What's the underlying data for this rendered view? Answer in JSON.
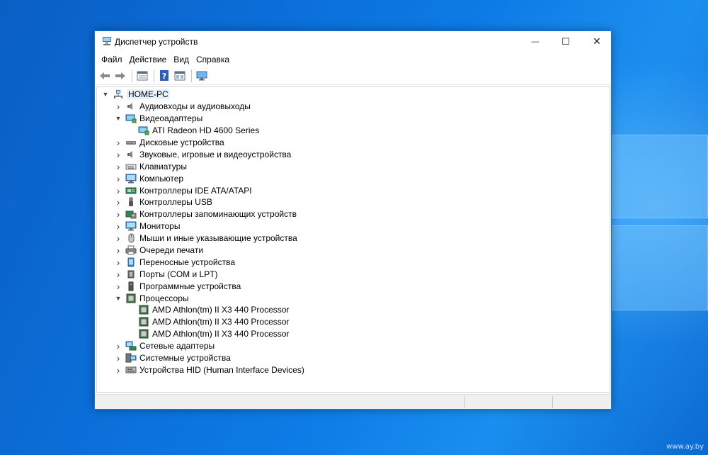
{
  "desktop": {
    "watermark": "www.ay.by"
  },
  "window": {
    "title": "Диспетчер устройств",
    "controls": {
      "minimize": "—",
      "maximize": "☐",
      "close": "✕"
    }
  },
  "menu": [
    "Файл",
    "Действие",
    "Вид",
    "Справка"
  ],
  "toolbar": {
    "buttons": [
      "back-icon",
      "forward-icon",
      "properties-icon",
      "help-icon",
      "show-hidden-icon",
      "monitor-scan-icon"
    ]
  },
  "tree": {
    "root": "HOME-PC",
    "items": [
      {
        "label": "Аудиовходы и аудиовыходы",
        "icon": "speaker-icon",
        "expanded": false
      },
      {
        "label": "Видеоадаптеры",
        "icon": "display-adapter-icon",
        "expanded": true
      },
      {
        "label": "ATI Radeon HD 4600 Series",
        "icon": "display-adapter-icon",
        "child": true
      },
      {
        "label": "Дисковые устройства",
        "icon": "disk-icon",
        "expanded": false
      },
      {
        "label": "Звуковые, игровые и видеоустройства",
        "icon": "speaker-icon",
        "expanded": false
      },
      {
        "label": "Клавиатуры",
        "icon": "keyboard-icon",
        "expanded": false
      },
      {
        "label": "Компьютер",
        "icon": "computer-icon",
        "expanded": false
      },
      {
        "label": "Контроллеры IDE ATA/ATAPI",
        "icon": "ide-controller-icon",
        "expanded": false
      },
      {
        "label": "Контроллеры USB",
        "icon": "usb-icon",
        "expanded": false
      },
      {
        "label": "Контроллеры запоминающих устройств",
        "icon": "storage-controller-icon",
        "expanded": false
      },
      {
        "label": "Мониторы",
        "icon": "monitor-icon",
        "expanded": false
      },
      {
        "label": "Мыши и иные указывающие устройства",
        "icon": "mouse-icon",
        "expanded": false
      },
      {
        "label": "Очереди печати",
        "icon": "printer-icon",
        "expanded": false
      },
      {
        "label": "Переносные устройства",
        "icon": "portable-device-icon",
        "expanded": false
      },
      {
        "label": "Порты (COM и LPT)",
        "icon": "port-icon",
        "expanded": false
      },
      {
        "label": "Программные устройства",
        "icon": "software-device-icon",
        "expanded": false
      },
      {
        "label": "Процессоры",
        "icon": "processor-icon",
        "expanded": true
      },
      {
        "label": "AMD Athlon(tm) II X3 440 Processor",
        "icon": "processor-icon",
        "child": true
      },
      {
        "label": "AMD Athlon(tm) II X3 440 Processor",
        "icon": "processor-icon",
        "child": true
      },
      {
        "label": "AMD Athlon(tm) II X3 440 Processor",
        "icon": "processor-icon",
        "child": true
      },
      {
        "label": "Сетевые адаптеры",
        "icon": "network-adapter-icon",
        "expanded": false
      },
      {
        "label": "Системные устройства",
        "icon": "system-device-icon",
        "expanded": false
      },
      {
        "label": "Устройства HID (Human Interface Devices)",
        "icon": "hid-icon",
        "expanded": false
      }
    ]
  }
}
